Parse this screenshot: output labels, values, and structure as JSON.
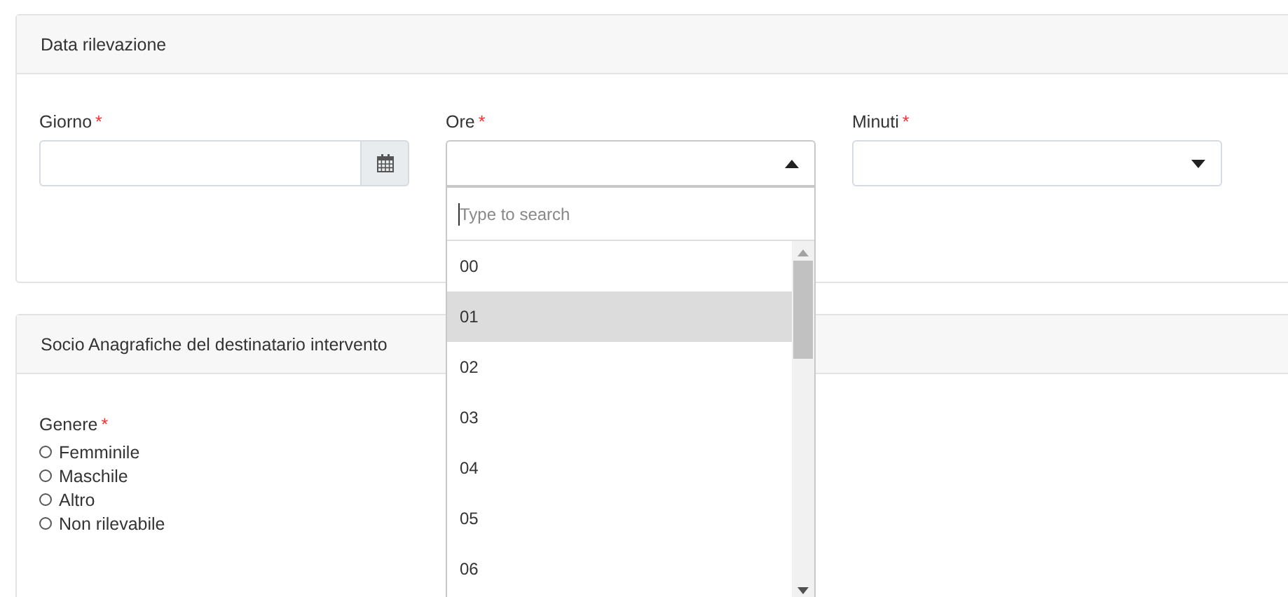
{
  "sections": [
    {
      "title": "Data rilevazione",
      "fields": [
        {
          "kind": "date",
          "label": "Giorno",
          "required_mark": "*"
        },
        {
          "kind": "select",
          "label": "Ore",
          "required_mark": "*",
          "expanded": true
        },
        {
          "kind": "select",
          "label": "Minuti",
          "required_mark": "*",
          "expanded": false
        }
      ]
    },
    {
      "title": "Socio Anagrafiche del destinatario intervento",
      "fields": [
        {
          "kind": "radio",
          "label": "Genere",
          "required_mark": "*",
          "options": [
            {
              "label": "Femminile",
              "checked": false
            },
            {
              "label": "Maschile",
              "checked": false
            },
            {
              "label": "Altro",
              "checked": false
            },
            {
              "label": "Non rilevabile",
              "checked": false
            }
          ]
        }
      ]
    }
  ],
  "dropdown": {
    "search": {
      "placeholder": "Type to search"
    },
    "options": [
      {
        "label": "00",
        "highlighted": false
      },
      {
        "label": "01",
        "highlighted": true
      },
      {
        "label": "02",
        "highlighted": false
      },
      {
        "label": "03",
        "highlighted": false
      },
      {
        "label": "04",
        "highlighted": false
      },
      {
        "label": "05",
        "highlighted": false
      },
      {
        "label": "06",
        "highlighted": false
      }
    ]
  }
}
